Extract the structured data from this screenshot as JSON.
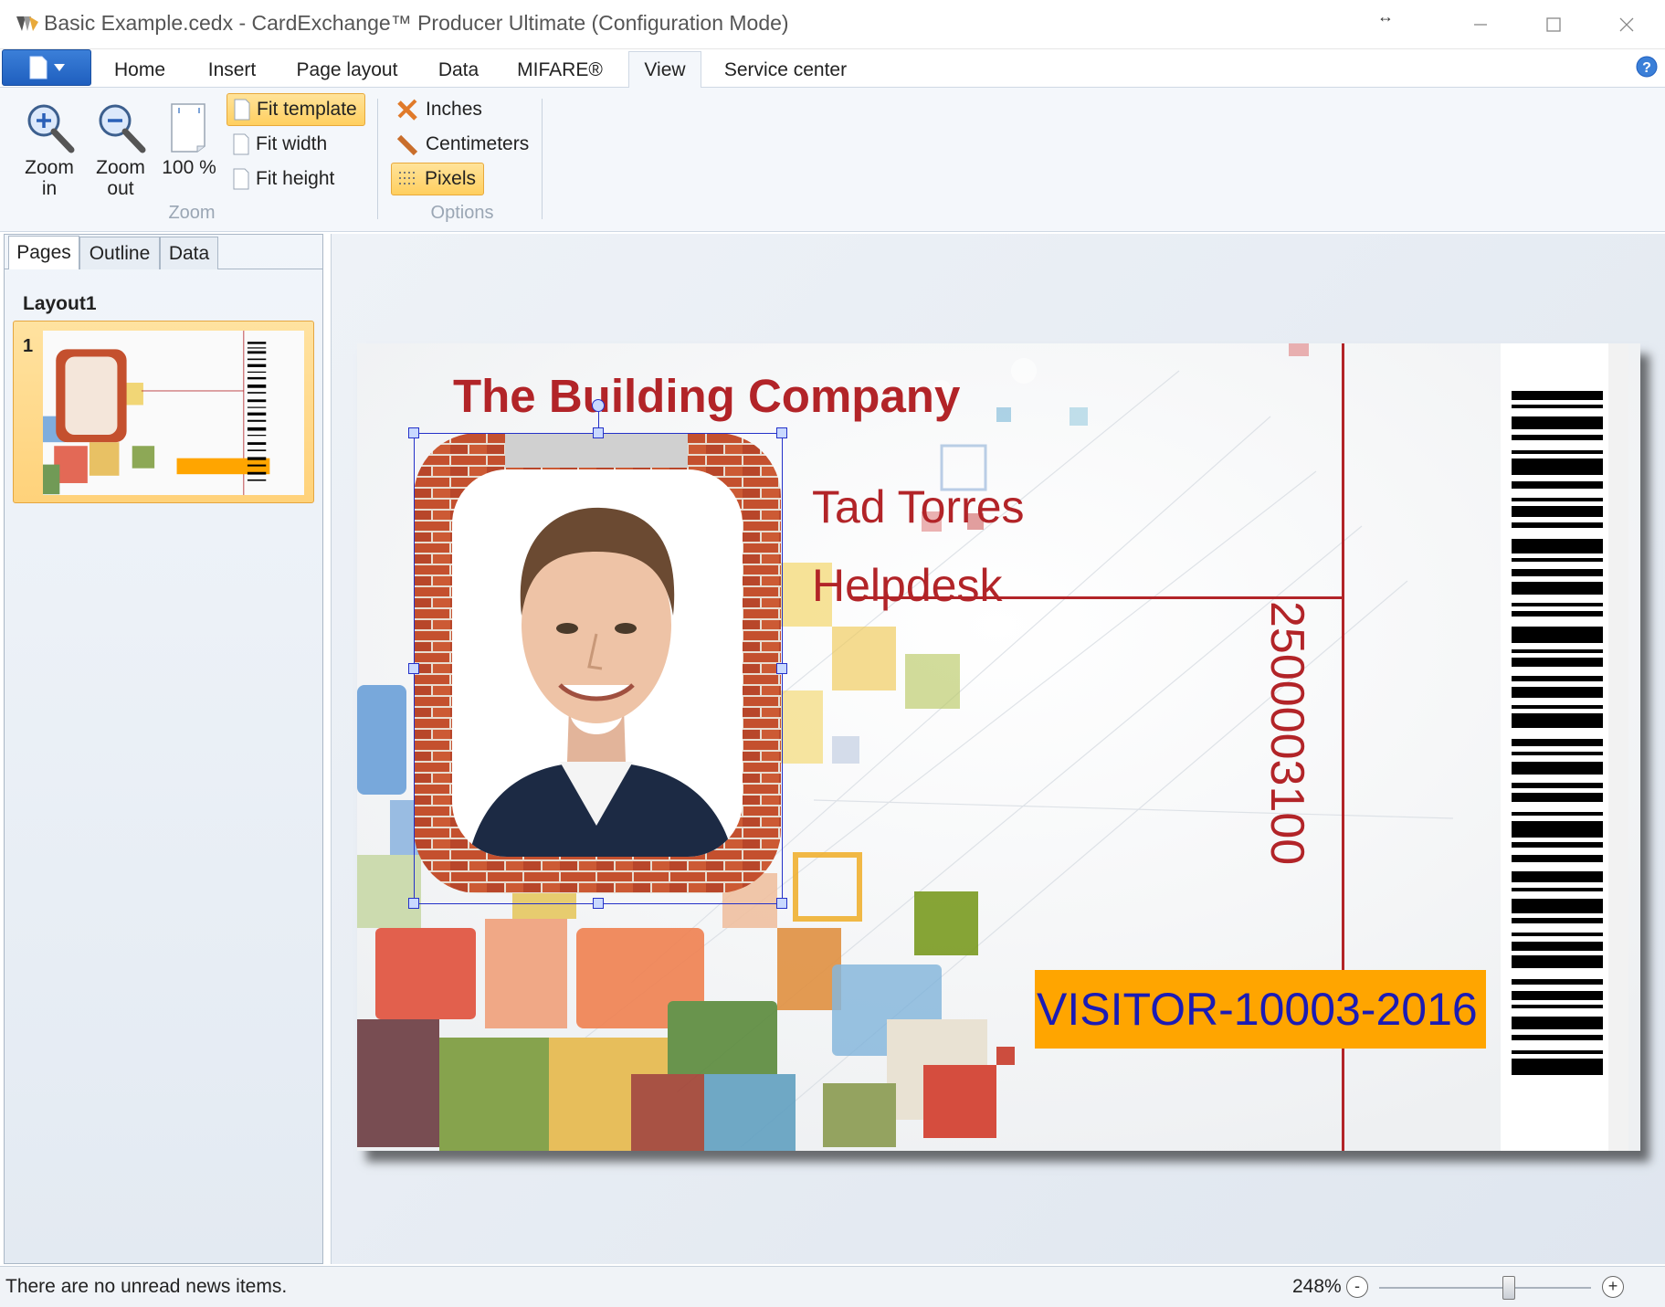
{
  "window": {
    "title": "Basic Example.cedx - CardExchange™ Producer Ultimate (Configuration Mode)",
    "resize_glyph": "↔"
  },
  "ribbon": {
    "tabs": [
      "Home",
      "Insert",
      "Page layout",
      "Data",
      "MIFARE®",
      "View",
      "Service center"
    ],
    "active_tab": "View",
    "zoom_group": {
      "label": "Zoom",
      "zoom_in": "Zoom in",
      "zoom_out": "Zoom out",
      "actual_size": "100 %",
      "fit_template": "Fit template",
      "fit_width": "Fit width",
      "fit_height": "Fit height",
      "selected": "Fit template"
    },
    "options_group": {
      "label": "Options",
      "inches": "Inches",
      "centimeters": "Centimeters",
      "pixels": "Pixels",
      "selected": "Pixels"
    }
  },
  "side_panel": {
    "tabs": [
      "Pages",
      "Outline",
      "Data"
    ],
    "active_tab": "Pages",
    "layout_name": "Layout1",
    "pages": [
      {
        "number": "1"
      }
    ]
  },
  "card": {
    "company": "The Building Company",
    "name": "Tad Torres",
    "department": "Helpdesk",
    "number": "2500003100",
    "visitor_id": "VISITOR-10003-2016"
  },
  "colors": {
    "accent_red": "#b22428",
    "badge_orange": "#ffa500",
    "visitor_text_blue": "#1b1bb5",
    "selection_blue": "#2431c9",
    "ribbon_highlight": "#ffd27a"
  },
  "status_bar": {
    "message": "There are no unread news items.",
    "zoom": "248%",
    "zoom_minus": "-",
    "zoom_plus": "+",
    "zoom_slider_position": 0.61
  }
}
